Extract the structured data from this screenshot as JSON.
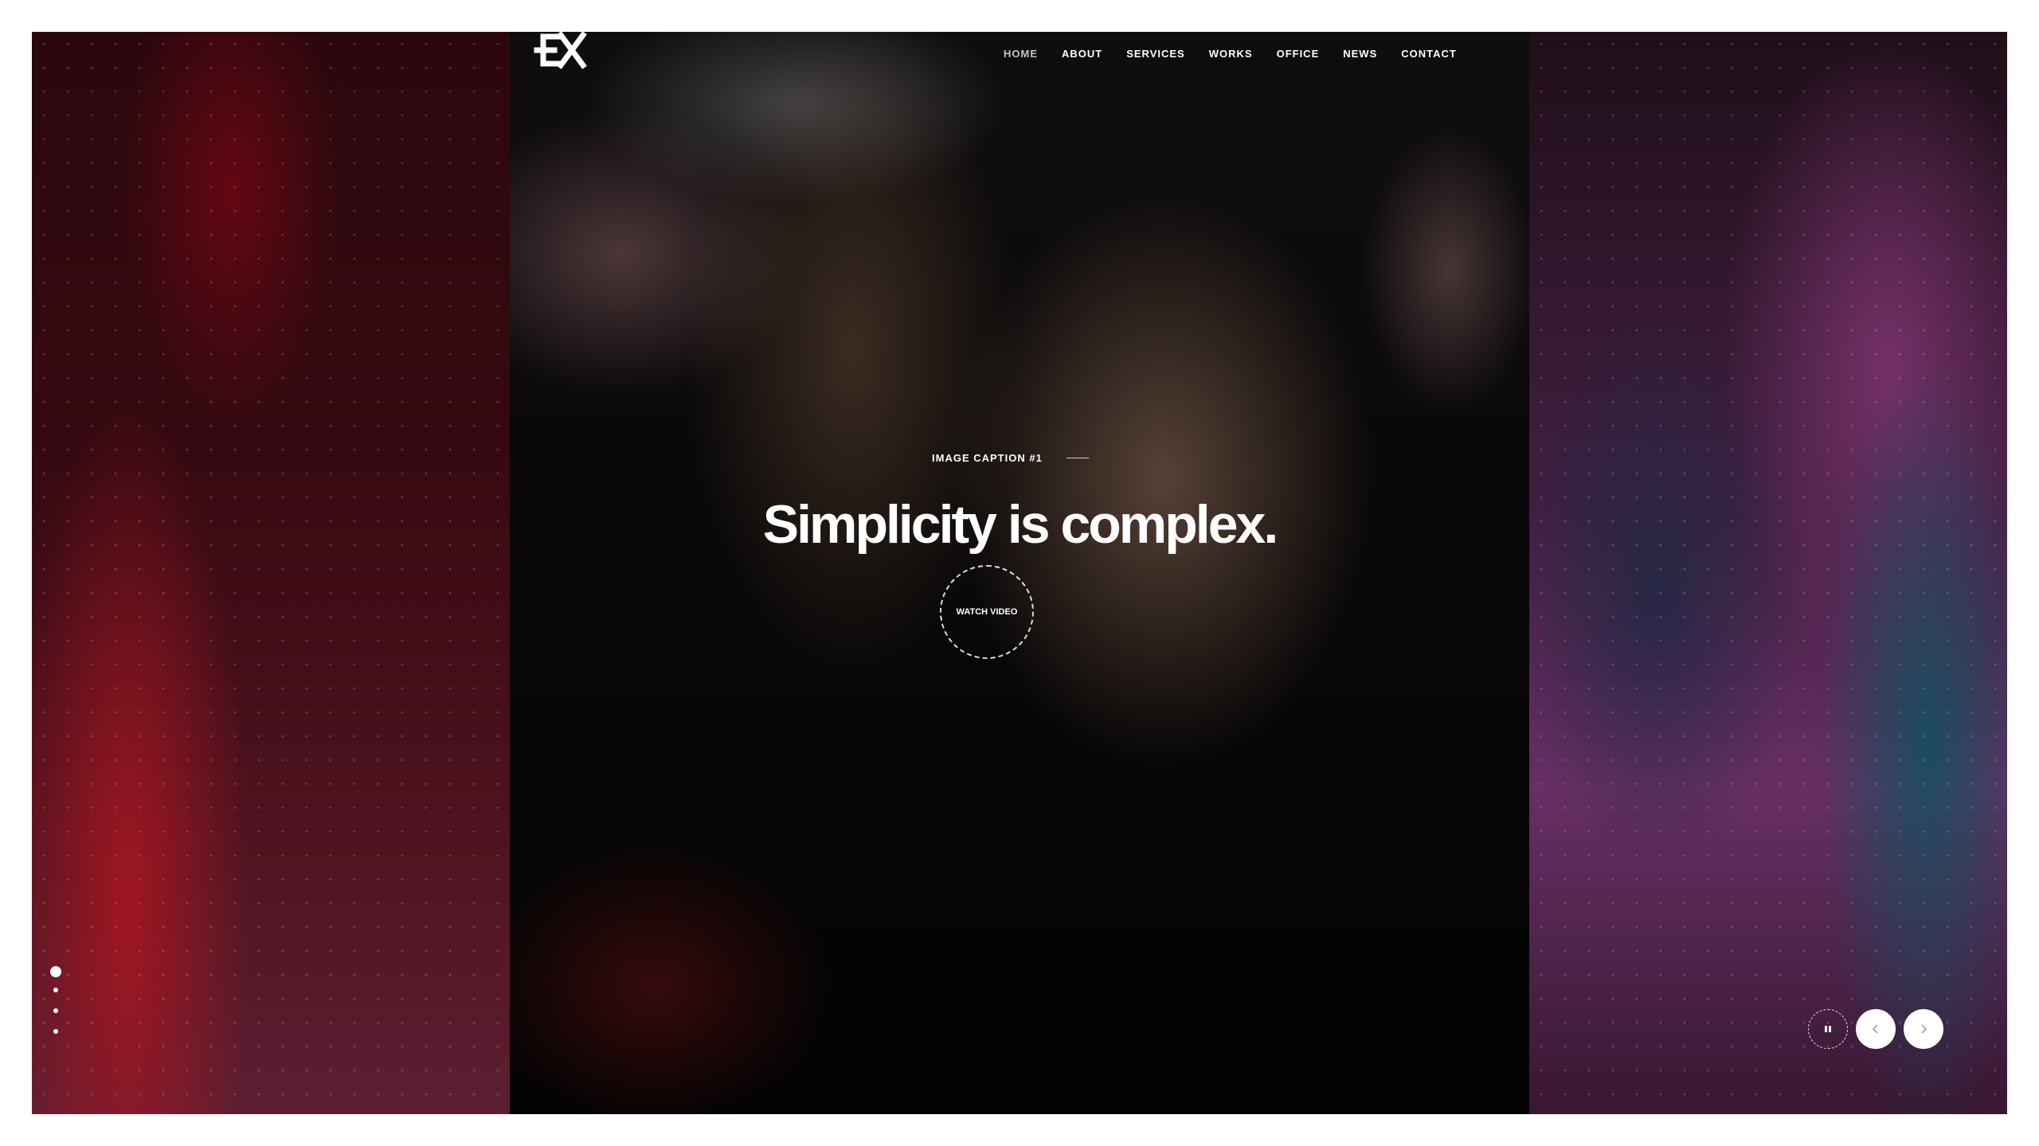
{
  "header": {
    "logo_alt": "EX",
    "nav": [
      {
        "label": "HOME"
      },
      {
        "label": "ABOUT"
      },
      {
        "label": "SERVICES"
      },
      {
        "label": "WORKS"
      },
      {
        "label": "OFFICE"
      },
      {
        "label": "NEWS"
      },
      {
        "label": "CONTACT"
      }
    ]
  },
  "hero": {
    "caption": "IMAGE CAPTION #1",
    "headline": "Simplicity is complex.",
    "watch_label": "WATCH VIDEO"
  },
  "pagination": {
    "count": 4,
    "active_index": 0
  },
  "controls": {
    "pause_icon": "pause-icon",
    "prev_icon": "chevron-left-icon",
    "next_icon": "chevron-right-icon"
  },
  "colors": {
    "text": "#ffffff",
    "left_accent": "#d21e2d",
    "right_accent": "#8a3f86",
    "right_teal": "#146e82"
  }
}
